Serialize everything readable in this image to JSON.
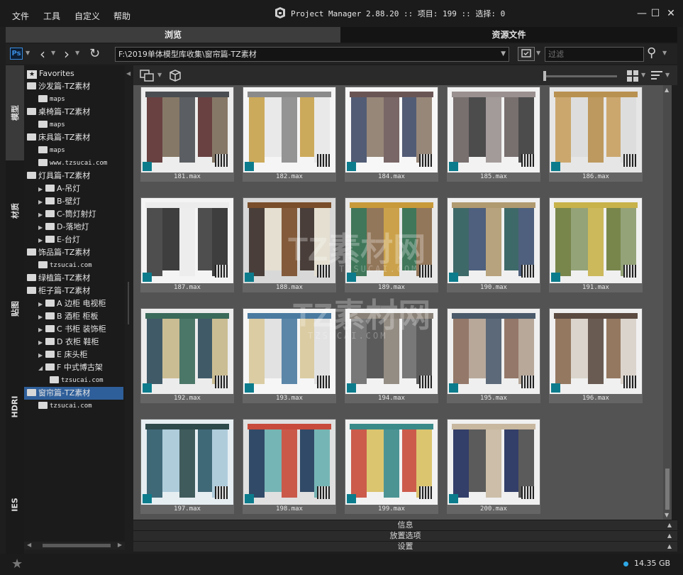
{
  "menu": [
    "文件",
    "工具",
    "自定义",
    "帮助"
  ],
  "title": {
    "text": "Project Manager 2.88.20  :: 项目: 199  :: 选择: 0",
    "window_controls": [
      "minimize-icon",
      "maximize-icon",
      "close-icon"
    ]
  },
  "tabs": [
    {
      "label": "浏览",
      "active": true
    },
    {
      "label": "资源文件",
      "active": false
    }
  ],
  "toolbar": {
    "app_badge": "Ps",
    "path": "F:\\2019单体模型库收集\\窗帘篇-TZ素材",
    "filter_placeholder": "过滤"
  },
  "vertical_tabs": [
    {
      "label": "模型",
      "active": true
    },
    {
      "label": "材质",
      "active": false
    },
    {
      "label": "贴图",
      "active": false
    },
    {
      "label": "HDRI",
      "active": false
    },
    {
      "label": "IES",
      "active": false
    }
  ],
  "tree": [
    {
      "label": "Favorites",
      "level": 0,
      "icon": "star-icon"
    },
    {
      "label": "沙发篇-TZ素材",
      "level": 0
    },
    {
      "label": "maps",
      "level": 1
    },
    {
      "label": "桌椅篇-TZ素材",
      "level": 0
    },
    {
      "label": "maps",
      "level": 1
    },
    {
      "label": "床具篇-TZ素材",
      "level": 0
    },
    {
      "label": "maps",
      "level": 1
    },
    {
      "label": "www.tzsucai.com",
      "level": 1
    },
    {
      "label": "灯具篇-TZ素材",
      "level": 0
    },
    {
      "label": "A-吊灯",
      "level": 1,
      "expandable": true
    },
    {
      "label": "B-壁灯",
      "level": 1,
      "expandable": true
    },
    {
      "label": "C-筒灯射灯",
      "level": 1,
      "expandable": true
    },
    {
      "label": "D-落地灯",
      "level": 1,
      "expandable": true
    },
    {
      "label": "E-台灯",
      "level": 1,
      "expandable": true
    },
    {
      "label": "饰品篇-TZ素材",
      "level": 0
    },
    {
      "label": "tzsucai.com",
      "level": 1
    },
    {
      "label": "绿植篇-TZ素材",
      "level": 0
    },
    {
      "label": "柜子篇-TZ素材",
      "level": 0
    },
    {
      "label": "A 边柜 电视柜",
      "level": 1,
      "expandable": true
    },
    {
      "label": "B 酒柜 柜板",
      "level": 1,
      "expandable": true
    },
    {
      "label": "C 书柜 装饰柜",
      "level": 1,
      "expandable": true
    },
    {
      "label": "D 衣柜 鞋柜",
      "level": 1,
      "expandable": true
    },
    {
      "label": "E 床头柜",
      "level": 1,
      "expandable": true
    },
    {
      "label": "F 中式博古架",
      "level": 1,
      "expanded": true
    },
    {
      "label": "tzsucai.com",
      "level": 2
    },
    {
      "label": "窗帘篇-TZ素材",
      "level": 0,
      "selected": true
    },
    {
      "label": "tzsucai.com",
      "level": 1
    }
  ],
  "items": [
    {
      "name": "181.max",
      "bg": "#ededed",
      "colors": [
        "#5a2d2d",
        "#4a4e52",
        "#7a6a58"
      ]
    },
    {
      "name": "182.max",
      "bg": "#f5f5f5",
      "colors": [
        "#c8a24a",
        "#8a8a8a",
        "#e8e8e8"
      ]
    },
    {
      "name": "184.max",
      "bg": "#f7f7f7",
      "colors": [
        "#3f4a66",
        "#6a5555",
        "#8c7a6a"
      ]
    },
    {
      "name": "185.max",
      "bg": "#f2f2f2",
      "colors": [
        "#6a6060",
        "#9a9090",
        "#3a3a3a"
      ]
    },
    {
      "name": "186.max",
      "bg": "#e6e6e6",
      "colors": [
        "#c8a060",
        "#b89050",
        "#dcdcdc"
      ]
    },
    {
      "name": "187.max",
      "bg": "#f4f4f4",
      "colors": [
        "#3c3c3c",
        "#ececec",
        "#2a2a2a"
      ]
    },
    {
      "name": "188.max",
      "bg": "#d8d8d8",
      "colors": [
        "#3a2e28",
        "#7a4e2a",
        "#e6e0d0"
      ]
    },
    {
      "name": "189.max",
      "bg": "#e8e8e8",
      "colors": [
        "#2e6a4a",
        "#c89a3a",
        "#8a6a4a"
      ]
    },
    {
      "name": "190.max",
      "bg": "#f0f0f0",
      "colors": [
        "#2a5a5a",
        "#b09a70",
        "#3c5070"
      ]
    },
    {
      "name": "191.max",
      "bg": "#f0f0f0",
      "colors": [
        "#6a7a3a",
        "#c8b24a",
        "#8a9a6a"
      ]
    },
    {
      "name": "192.max",
      "bg": "#ececec",
      "colors": [
        "#2e4a5a",
        "#3a6a5a",
        "#c8b88a"
      ]
    },
    {
      "name": "193.max",
      "bg": "#f6f6f6",
      "colors": [
        "#d8c89a",
        "#4a7aa0",
        "#e0e0e0"
      ]
    },
    {
      "name": "194.max",
      "bg": "#f2f2f2",
      "colors": [
        "#6a6a6a",
        "#8a8278",
        "#4a4a4a"
      ]
    },
    {
      "name": "195.max",
      "bg": "#efefef",
      "colors": [
        "#8a6a5a",
        "#4a5a6a",
        "#b0a090"
      ]
    },
    {
      "name": "196.max",
      "bg": "#f0f0f0",
      "colors": [
        "#8a6a50",
        "#5a4a40",
        "#d8d0c8"
      ]
    },
    {
      "name": "197.max",
      "bg": "#e6eef2",
      "colors": [
        "#2e5a6a",
        "#2e4a4a",
        "#a8c8d8"
      ]
    },
    {
      "name": "198.max",
      "bg": "#e0e0e0",
      "colors": [
        "#1e3a5a",
        "#c84a3a",
        "#6ab0b0"
      ]
    },
    {
      "name": "199.max",
      "bg": "#f2f2f2",
      "colors": [
        "#c84a3a",
        "#3a8a8a",
        "#d8c060"
      ]
    },
    {
      "name": "200.max",
      "bg": "#f0f0f0",
      "colors": [
        "#1e2a5a",
        "#c8b8a0",
        "#4a4a4a"
      ]
    }
  ],
  "watermark": {
    "text": "TZ素材网",
    "sub": "TZSUCAI.COM"
  },
  "panels": [
    "信息",
    "放置选项",
    "设置"
  ],
  "status": {
    "disk": "14.35 GB",
    "indicator_color": "#2fa8e6"
  }
}
